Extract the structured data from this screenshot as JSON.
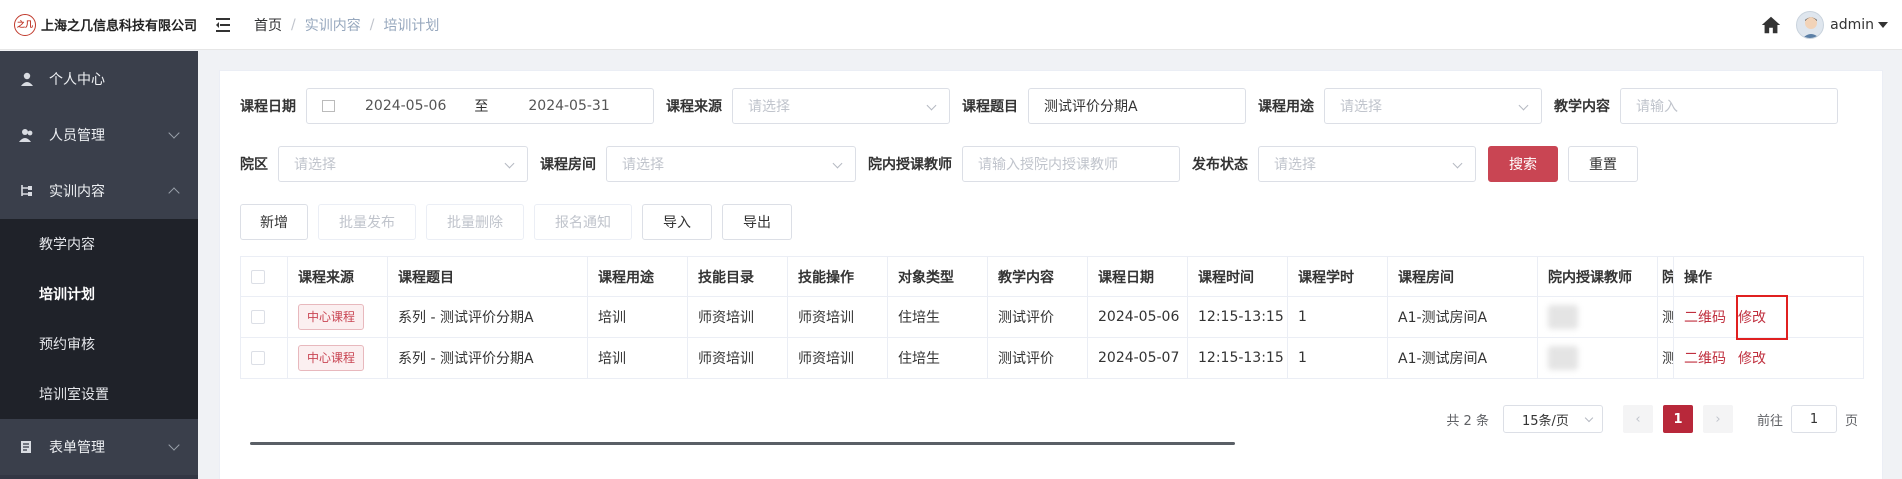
{
  "header": {
    "logo_mark": "之几",
    "company": "上海之几信息科技有限公司",
    "breadcrumb": [
      "首页",
      "实训内容",
      "培训计划"
    ],
    "user": "admin"
  },
  "sidebar": {
    "items": [
      {
        "label": "个人中心",
        "icon": "user-icon"
      },
      {
        "label": "人员管理",
        "icon": "users-icon"
      },
      {
        "label": "实训内容",
        "icon": "tree-icon"
      },
      {
        "label": "教学内容"
      },
      {
        "label": "培训计划"
      },
      {
        "label": "预约审核"
      },
      {
        "label": "培训室设置"
      },
      {
        "label": "表单管理",
        "icon": "form-icon"
      }
    ]
  },
  "filters": {
    "course_date_label": "课程日期",
    "date_start": "2024-05-06",
    "date_to": "至",
    "date_end": "2024-05-31",
    "source_label": "课程来源",
    "source_placeholder": "请选择",
    "topic_label": "课程题目",
    "topic_value": "测试评价分期A",
    "purpose_label": "课程用途",
    "purpose_placeholder": "请选择",
    "content_label": "教学内容",
    "content_placeholder": "请输入",
    "campus_label": "院区",
    "campus_placeholder": "请选择",
    "room_label": "课程房间",
    "room_placeholder": "请选择",
    "teacher_label": "院内授课教师",
    "teacher_placeholder": "请输入授院内授课教师",
    "status_label": "发布状态",
    "status_placeholder": "请选择",
    "search": "搜索",
    "reset": "重置"
  },
  "toolbar": {
    "add": "新增",
    "batch_publish": "批量发布",
    "batch_delete": "批量删除",
    "signup_notice": "报名通知",
    "import": "导入",
    "export": "导出"
  },
  "table": {
    "columns": [
      "课程来源",
      "课程题目",
      "课程用途",
      "技能目录",
      "技能操作",
      "对象类型",
      "教学内容",
      "课程日期",
      "课程时间",
      "课程学时",
      "课程房间",
      "院内授课教师",
      "院",
      "操作"
    ],
    "rows": [
      {
        "source": "中心课程",
        "topic": "系列 - 测试评价分期A",
        "purpose": "培训",
        "skill_dir": "师资培训",
        "skill_op": "师资培训",
        "target": "住培生",
        "content": "测试评价",
        "date": "2024-05-06",
        "time": "12:15-13:15",
        "hours": "1",
        "room": "A1-测试房间A",
        "extra": "测",
        "op_qr": "二维码",
        "op_edit": "修改"
      },
      {
        "source": "中心课程",
        "topic": "系列 - 测试评价分期A",
        "purpose": "培训",
        "skill_dir": "师资培训",
        "skill_op": "师资培训",
        "target": "住培生",
        "content": "测试评价",
        "date": "2024-05-07",
        "time": "12:15-13:15",
        "hours": "1",
        "room": "A1-测试房间A",
        "extra": "测",
        "op_qr": "二维码",
        "op_edit": "修改"
      }
    ]
  },
  "pagination": {
    "total": "共 2 条",
    "page_size": "15条/页",
    "current": "1",
    "goto_label": "前往",
    "goto_value": "1",
    "page_unit": "页",
    "prev": "‹",
    "next": "›"
  },
  "colors": {
    "accent": "#c94553",
    "sidebar": "#333744"
  }
}
